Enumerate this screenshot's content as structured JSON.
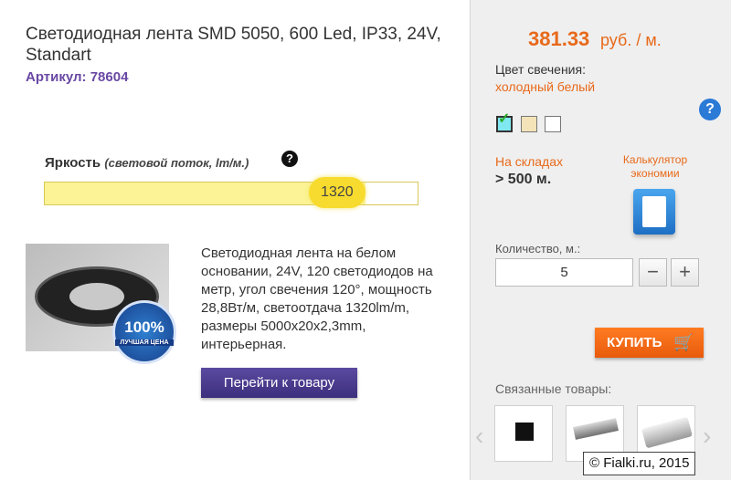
{
  "product": {
    "title": "Светодиодная лента SMD 5050, 600 Led, IP33, 24V, Standart",
    "article": "Артикул: 78604",
    "brightness_label": "Яркость",
    "brightness_sub": "(световой поток, lm/м.)",
    "brightness_value": "1320",
    "brightness_fraction": 0.86,
    "badge_percent": "100%",
    "badge_text": "ЛУЧШАЯ ЦЕНА",
    "description": "Светодиодная лента на белом основании, 24V, 120 светодиодов на метр, угол свечения 120°, мощность 28,8Вт/м, светоотдача 1320lm/m, размеры 5000x20x2,3mm, интерьерная.",
    "goto_button": "Перейти к товару"
  },
  "side": {
    "price": "381.33",
    "price_unit": "руб. / м.",
    "color_label": "Цвет свечения:",
    "color_value": "холодный белый",
    "stock_label": "На складах",
    "stock_value": "> 500 м.",
    "calc_label": "Калькулятор экономии",
    "qty_label": "Количество, м.:",
    "qty_value": "5",
    "minus": "−",
    "plus": "+",
    "buy_button": "КУПИТЬ",
    "related_label": "Связанные товары:"
  },
  "watermark": "© Fialki.ru, 2015",
  "colors": {
    "accent": "#e8691a",
    "article": "#6a48a4",
    "button": "#4a3b8f"
  }
}
